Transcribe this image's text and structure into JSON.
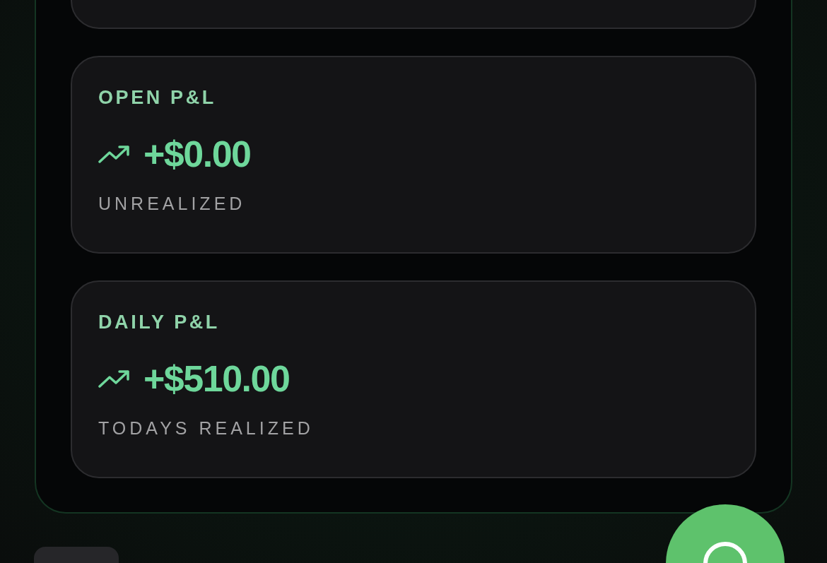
{
  "cards": [
    {
      "label": "OPEN P&L",
      "kind": "gain",
      "value": "+$0.00",
      "sublabel": "UNREALIZED"
    },
    {
      "label": "DAILY P&L",
      "kind": "gain",
      "value": "+$510.00",
      "sublabel": "TODAYS REALIZED"
    }
  ]
}
